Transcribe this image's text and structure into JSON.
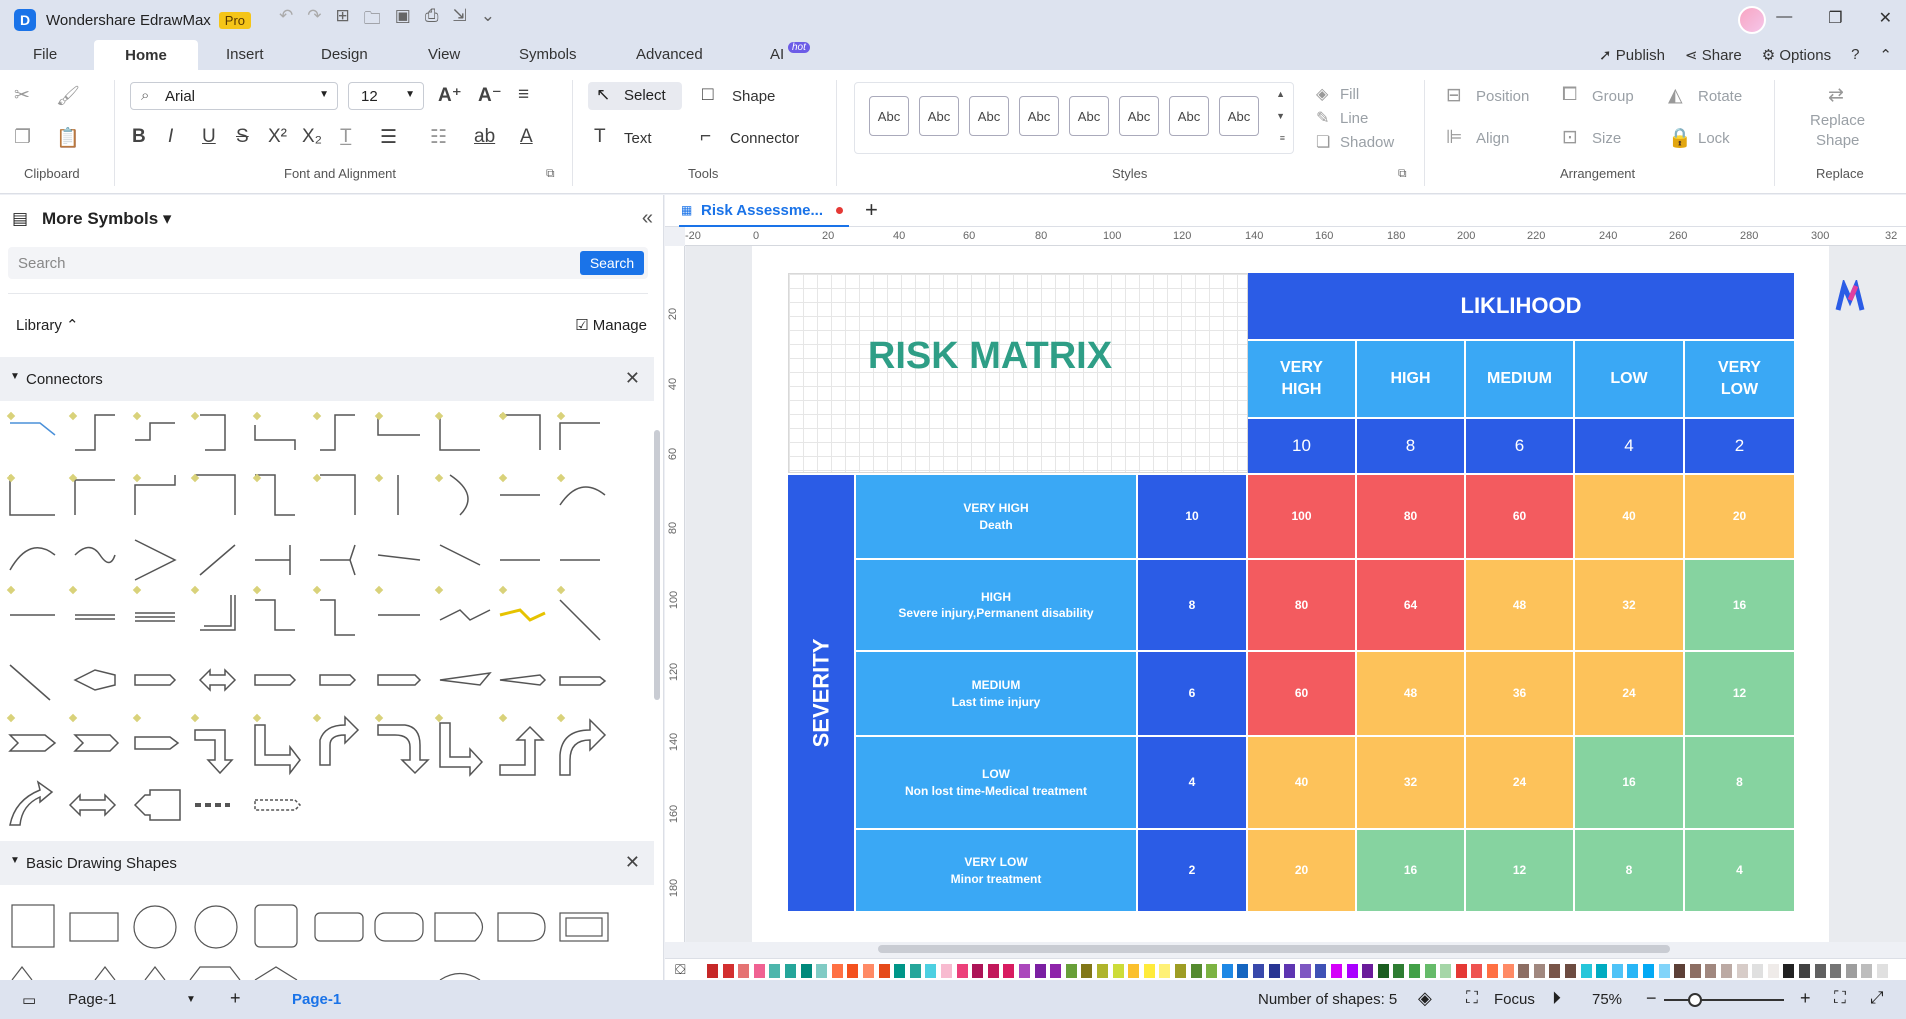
{
  "app": {
    "name": "Wondershare EdrawMax",
    "badge": "Pro"
  },
  "menu": {
    "items": [
      "File",
      "Home",
      "Insert",
      "Design",
      "View",
      "Symbols",
      "Advanced",
      "AI"
    ],
    "active": "Home",
    "ai_badge": "hot",
    "right": {
      "publish": "Publish",
      "share": "Share",
      "options": "Options"
    }
  },
  "ribbon": {
    "font_name": "Arial",
    "font_size": "12",
    "select": "Select",
    "shape": "Shape",
    "text": "Text",
    "connector": "Connector",
    "style_sample": "Abc",
    "fill": "Fill",
    "line": "Line",
    "shadow": "Shadow",
    "position": "Position",
    "group": "Group",
    "rotate": "Rotate",
    "align": "Align",
    "size": "Size",
    "lock": "Lock",
    "replace_shape_1": "Replace",
    "replace_shape_2": "Shape",
    "groups": {
      "clipboard": "Clipboard",
      "font": "Font and Alignment",
      "tools": "Tools",
      "styles": "Styles",
      "arrangement": "Arrangement",
      "replace": "Replace"
    }
  },
  "left_panel": {
    "title": "More Symbols",
    "search_placeholder": "Search",
    "search_button": "Search",
    "library": "Library",
    "manage": "Manage",
    "section_connectors": "Connectors",
    "section_basic": "Basic Drawing Shapes"
  },
  "tab": {
    "title": "Risk Assessme..."
  },
  "ruler": {
    "h": [
      "-20",
      "0",
      "20",
      "40",
      "60",
      "80",
      "100",
      "120",
      "140",
      "160",
      "180",
      "200",
      "220",
      "240",
      "260",
      "280",
      "300",
      "32"
    ],
    "v": [
      "20",
      "40",
      "60",
      "80",
      "100",
      "120",
      "140",
      "160",
      "180"
    ]
  },
  "matrix": {
    "title": "RISK MATRIX",
    "likelihood_label": "LIKLIHOOD",
    "severity_label": "SEVERITY",
    "likelihood": [
      {
        "label": "VERY\nHIGH",
        "score": "10"
      },
      {
        "label": "HIGH",
        "score": "8"
      },
      {
        "label": "MEDIUM",
        "score": "6"
      },
      {
        "label": "LOW",
        "score": "4"
      },
      {
        "label": "VERY\nLOW",
        "score": "2"
      }
    ],
    "severity": [
      {
        "level": "VERY HIGH",
        "desc": "Death",
        "score": "10"
      },
      {
        "level": "HIGH",
        "desc": "Severe injury,Permanent disability",
        "score": "8"
      },
      {
        "level": "MEDIUM",
        "desc": "Last time injury",
        "score": "6"
      },
      {
        "level": "LOW",
        "desc": "Non lost time-Medical treatment",
        "score": "4"
      },
      {
        "level": "VERY LOW",
        "desc": "Minor treatment",
        "score": "2"
      }
    ],
    "values": [
      [
        "100",
        "80",
        "60",
        "40",
        "20"
      ],
      [
        "80",
        "64",
        "48",
        "32",
        "16"
      ],
      [
        "60",
        "48",
        "36",
        "24",
        "12"
      ],
      [
        "40",
        "32",
        "24",
        "16",
        "8"
      ],
      [
        "20",
        "16",
        "12",
        "8",
        "4"
      ]
    ],
    "colors": {
      "red": "#f35b5f",
      "orange": "#fdc25a",
      "green": "#86d3a0",
      "blue_dark": "#2b5ce6",
      "blue_light": "#3aa8f5"
    }
  },
  "status": {
    "page_select": "Page-1",
    "page_tab": "Page-1",
    "shapes": "Number of shapes: 5",
    "focus": "Focus",
    "zoom": "75%"
  }
}
